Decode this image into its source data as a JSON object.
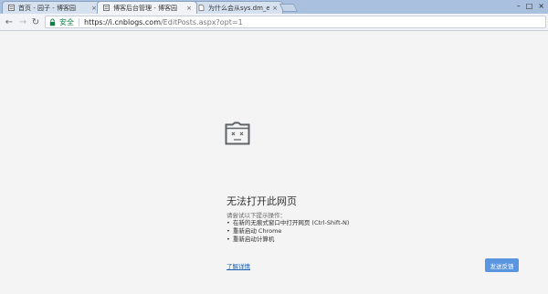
{
  "tabs": [
    {
      "label": "首页 - 园子 - 博客园",
      "close": "×",
      "active": false,
      "icon": "cnblogs-favicon-icon"
    },
    {
      "label": "博客后台管理 - 博客园",
      "close": "×",
      "active": true,
      "icon": "cnblogs-favicon-icon"
    },
    {
      "label": "为什么会从sys.dm_exec...",
      "close": "×",
      "active": false,
      "icon": "page-favicon-icon"
    }
  ],
  "window": {
    "minimize": "–",
    "maximize": "□",
    "close": "×"
  },
  "toolbar": {
    "back": "←",
    "forward": "→",
    "reload": "↻",
    "secure_label": "安全",
    "url_host": "https://i.cnblogs.com",
    "url_path": "/EditPosts.aspx?opt=1"
  },
  "error_page": {
    "heading": "无法打开此网页",
    "hint": "请尝试以下提示操作：",
    "suggestions": [
      "在新的无痕式窗口中打开网页 (Ctrl-Shift-N)",
      "重新启动 Chrome",
      "重新启动计算机"
    ],
    "details_link": "了解详情",
    "feedback_button": "发送反馈"
  },
  "colors": {
    "secure_green": "#0b8043",
    "link_blue": "#1a5fb4",
    "button_blue": "#5a95e0",
    "tabstrip_blue": "#a9c0de"
  }
}
